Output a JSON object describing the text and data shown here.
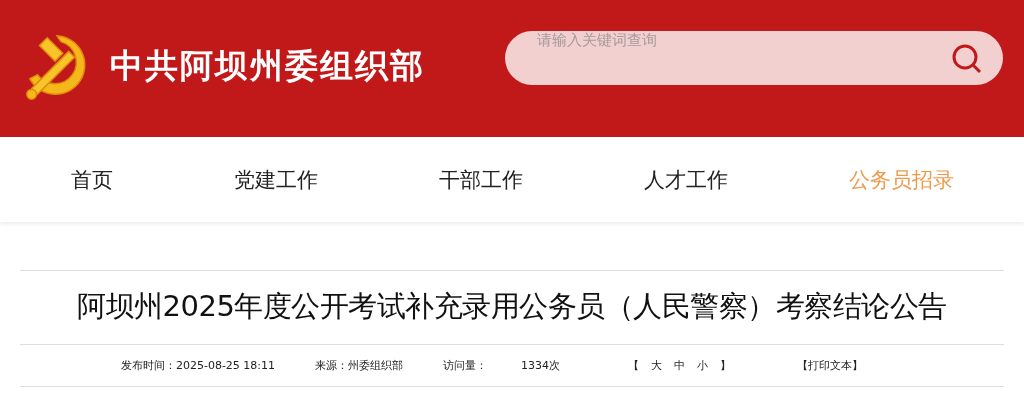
{
  "header": {
    "title": "中共阿坝州委组织部"
  },
  "search": {
    "placeholder": "请输入关键词查询"
  },
  "nav": [
    {
      "label": "首页",
      "selected": false
    },
    {
      "label": "党建工作",
      "selected": false
    },
    {
      "label": "干部工作",
      "selected": false
    },
    {
      "label": "人才工作",
      "selected": false
    },
    {
      "label": "公务员招录",
      "selected": true
    }
  ],
  "article": {
    "title": "阿坝州2025年度公开考试补充录用公务员（人民警察）考察结论公告",
    "meta": {
      "published_label": "发布时间：",
      "published": "2025-08-25 18:11",
      "source": "来源：州委组织部",
      "views_label": "访问量：",
      "views": "1334次",
      "font_size": {
        "open": "【",
        "options": [
          "大",
          "中",
          "小"
        ],
        "close": "】"
      },
      "print": "【打印文本】"
    }
  }
}
